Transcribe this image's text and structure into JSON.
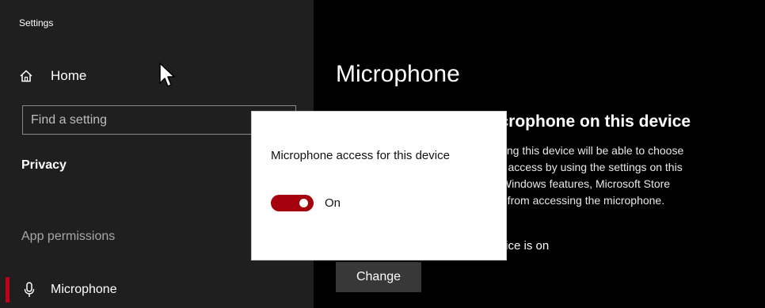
{
  "window": {
    "title": "Settings"
  },
  "sidebar": {
    "home_label": "Home",
    "search_placeholder": "Find a setting",
    "section_label": "Privacy",
    "group_label": "App permissions",
    "selected_item_label": "Microphone",
    "accent_color": "#c3001c"
  },
  "main": {
    "page_title": "Microphone",
    "section_heading_visible": "microphone on this device",
    "description_lines": [
      "using this device will be able to choose",
      "ne access by using the settings on this",
      "s Windows features, Microsoft Store",
      "ps from accessing the microphone."
    ],
    "status_visible": "device is on",
    "change_button_label": "Change"
  },
  "popup": {
    "title": "Microphone access for this device",
    "toggle_state_label": "On",
    "toggle_on": true,
    "toggle_color": "#a4000e"
  },
  "icons": {
    "home": "home-icon",
    "microphone": "microphone-icon",
    "cursor": "mouse-cursor-icon"
  }
}
